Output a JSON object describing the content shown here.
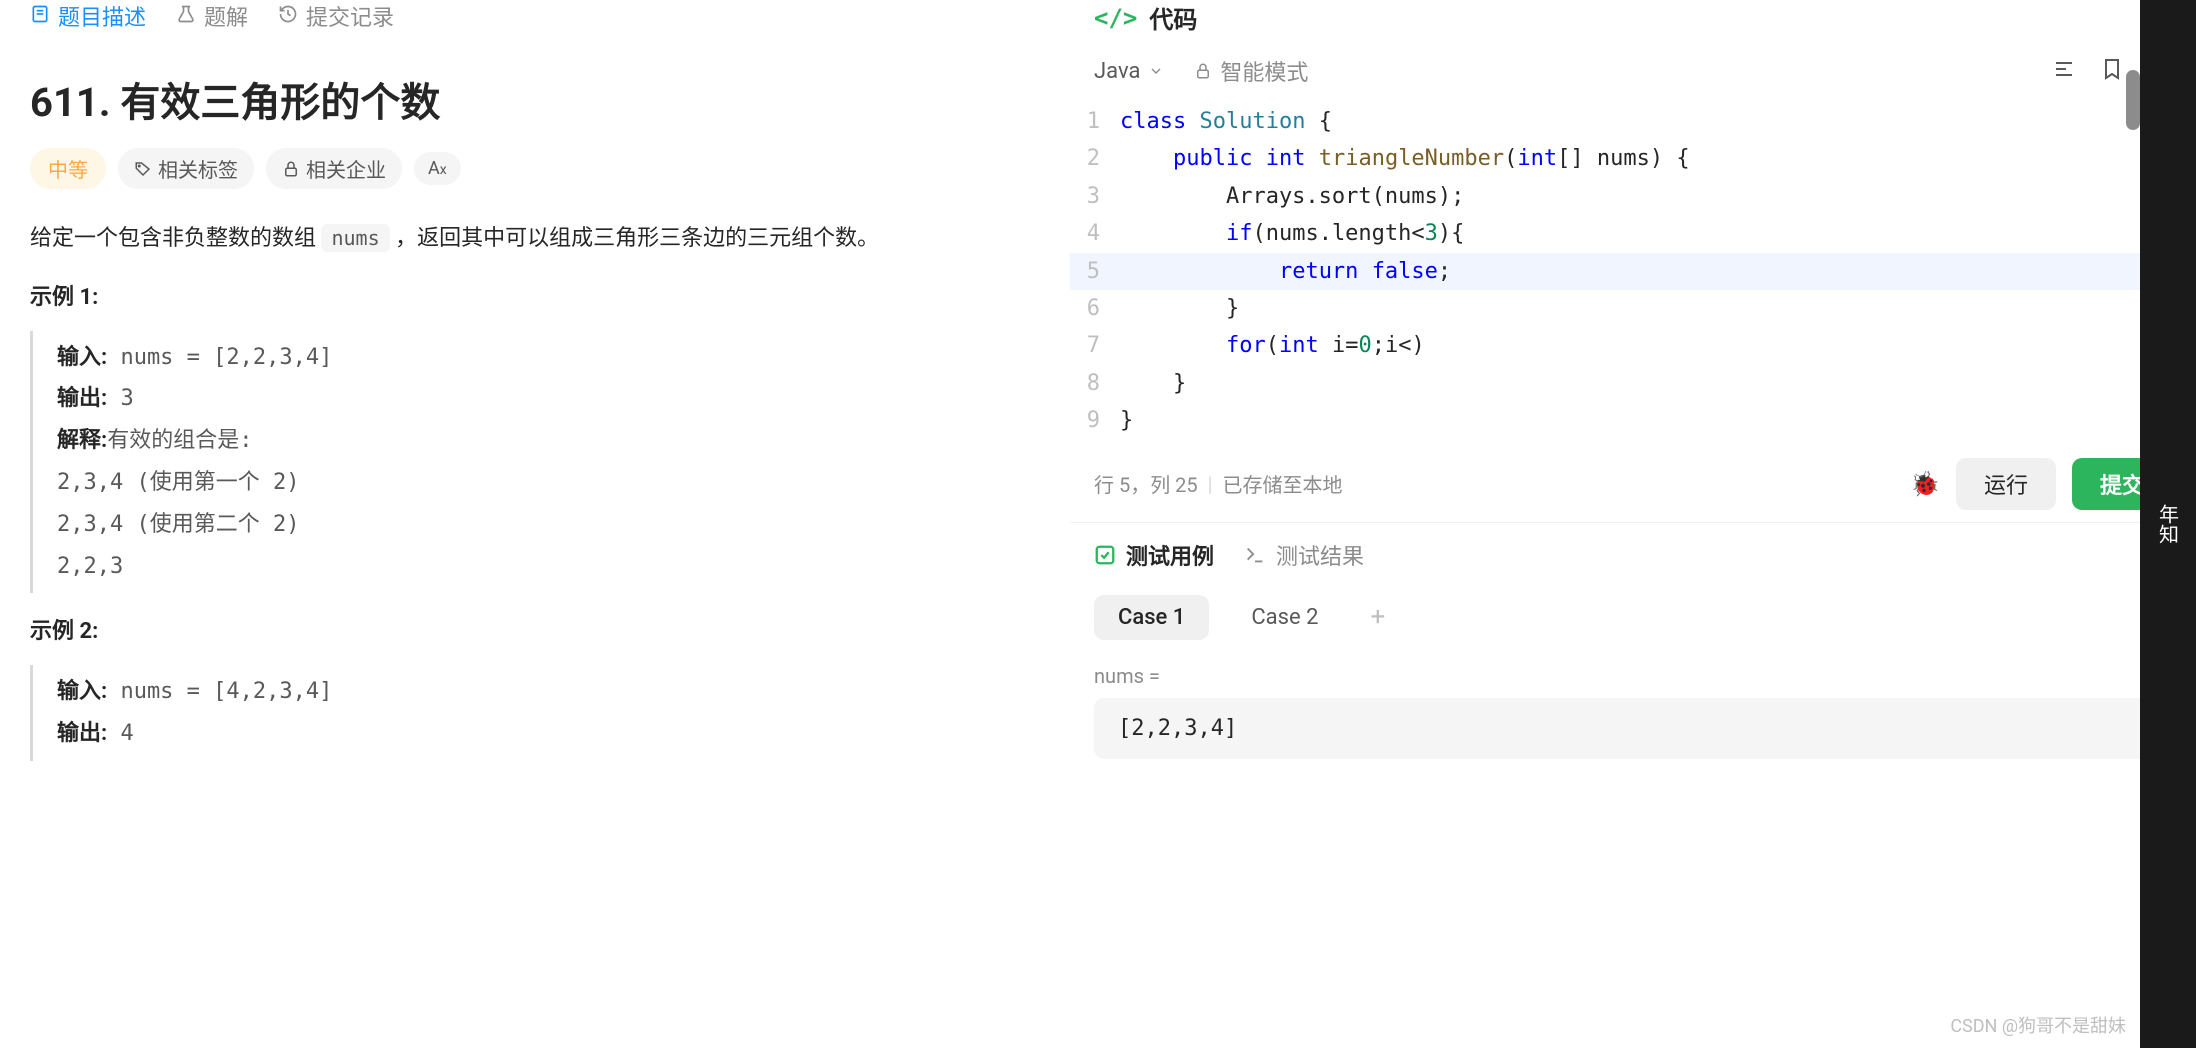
{
  "leftTabs": {
    "description": "题目描述",
    "solution": "题解",
    "submissions": "提交记录"
  },
  "problem": {
    "title": "611. 有效三角形的个数",
    "difficulty": "中等",
    "tagsLabel": "相关标签",
    "companiesLabel": "相关企业",
    "fontButton": "A",
    "descriptionPrefix": "给定一个包含非负整数的数组 ",
    "descriptionCode": "nums",
    "descriptionSuffix": " ，返回其中可以组成三角形三条边的三元组个数。"
  },
  "examples": [
    {
      "title": "示例 1:",
      "inputLabel": "输入:",
      "inputValue": " nums = [2,2,3,4]",
      "outputLabel": "输出:",
      "outputValue": " 3",
      "explainLabel": "解释:",
      "explainValue": "有效的组合是:",
      "explainLines": [
        "2,3,4 (使用第一个 2)",
        "2,3,4 (使用第二个 2)",
        "2,2,3"
      ]
    },
    {
      "title": "示例 2:",
      "inputLabel": "输入:",
      "inputValue": " nums = [4,2,3,4]",
      "outputLabel": "输出:",
      "outputValue": " 4"
    }
  ],
  "code": {
    "headerLabel": "代码",
    "language": "Java",
    "smartMode": "智能模式",
    "lines": [
      {
        "num": "1",
        "html": "<span class='tok-keyword'>class</span> <span class='tok-class'>Solution</span> {"
      },
      {
        "num": "2",
        "html": "    <span class='tok-keyword'>public</span> <span class='tok-keyword'>int</span> <span class='tok-method'>triangleNumber</span>(<span class='tok-keyword'>int</span>[] nums) {"
      },
      {
        "num": "3",
        "html": "        Arrays.sort(nums);"
      },
      {
        "num": "4",
        "html": "        <span class='tok-keyword'>if</span>(nums.length&lt;<span class='tok-number'>3</span>){"
      },
      {
        "num": "5",
        "html": "            <span class='tok-keyword'>return</span> <span class='tok-literal'>false</span>;",
        "highlighted": true
      },
      {
        "num": "6",
        "html": "        }"
      },
      {
        "num": "7",
        "html": "        <span class='tok-keyword'>for</span>(<span class='tok-keyword'>int</span> i=<span class='tok-number'>0</span>;i&lt;)"
      },
      {
        "num": "8",
        "html": "    }"
      },
      {
        "num": "9",
        "html": "}"
      }
    ],
    "statusPos": "行 5，列 25",
    "statusSaved": "已存储至本地",
    "runLabel": "运行",
    "submitLabel": "提交"
  },
  "test": {
    "casesTab": "测试用例",
    "resultsTab": "测试结果",
    "case1": "Case 1",
    "case2": "Case 2",
    "inputLabel": "nums =",
    "inputValue": "[2,2,3,4]"
  },
  "sliver": "年知",
  "watermark": "CSDN @狗哥不是甜妹"
}
